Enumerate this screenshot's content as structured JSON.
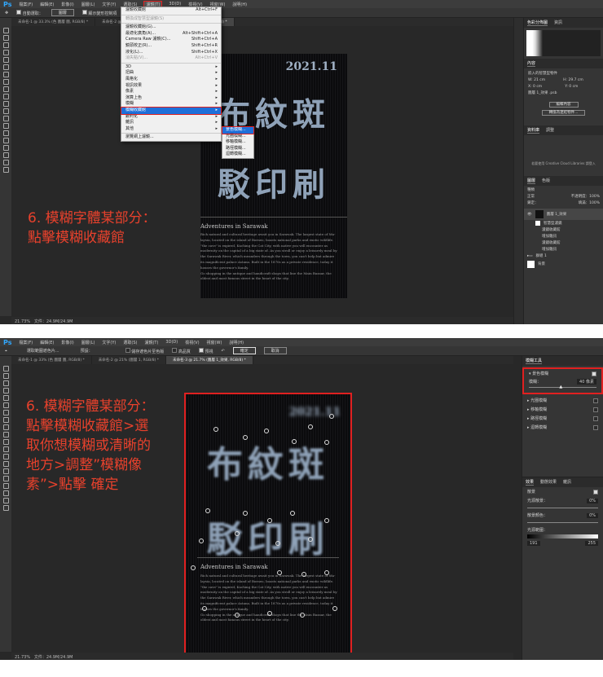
{
  "menubar": {
    "logo": "Ps",
    "items": [
      "檔案(F)",
      "編輯(E)",
      "影像(I)",
      "圖層(L)",
      "文字(Y)",
      "選取(S)",
      "濾鏡(T)",
      "3D(D)",
      "檢視(V)",
      "視窗(W)",
      "說明(H)"
    ]
  },
  "top": {
    "options": {
      "auto_select": "自動選取：",
      "auto_select_value": "圖層",
      "show_transform": "顯示變形控制項"
    },
    "tabs": [
      "未命名-1 @ 33.3% (色 圖層 圖, RGB/8) *",
      "未命名-2 @ 21% (圖層 1, RGB/8) *",
      "未命名-3 @ 21.7% (RGB/8) *"
    ],
    "filter_menu": [
      {
        "label": "濾鏡收藏館",
        "shortcut": "Alt+Ctrl+F"
      },
      {
        "label": "轉換成智慧型濾鏡(S)",
        "shortcut": "",
        "disabled": true
      },
      {
        "label": "濾鏡收藏館(G)...",
        "shortcut": ""
      },
      {
        "label": "最適化廣角(A)...",
        "shortcut": "Alt+Shift+Ctrl+A"
      },
      {
        "label": "Camera Raw 濾鏡(C)...",
        "shortcut": "Shift+Ctrl+A"
      },
      {
        "label": "鏡頭校正(R)...",
        "shortcut": "Shift+Ctrl+R"
      },
      {
        "label": "液化(L)...",
        "shortcut": "Shift+Ctrl+X"
      },
      {
        "label": "消失點(V)...",
        "shortcut": "Alt+Ctrl+V",
        "disabled": true
      },
      {
        "label": "3D",
        "shortcut": "▸"
      },
      {
        "label": "扭曲",
        "shortcut": "▸"
      },
      {
        "label": "風格化",
        "shortcut": "▸"
      },
      {
        "label": "視訊效果",
        "shortcut": "▸"
      },
      {
        "label": "像素",
        "shortcut": "▸"
      },
      {
        "label": "演算上色",
        "shortcut": "▸"
      },
      {
        "label": "模糊",
        "shortcut": "▸"
      },
      {
        "label": "模糊收藏館",
        "shortcut": "▸",
        "highlight": true
      },
      {
        "label": "銳利化",
        "shortcut": "▸"
      },
      {
        "label": "雜訊",
        "shortcut": "▸"
      },
      {
        "label": "其他",
        "shortcut": "▸"
      },
      {
        "label": "瀏覽網上濾鏡...",
        "shortcut": ""
      }
    ],
    "blur_submenu": [
      "景色模糊...",
      "光圈模糊...",
      "移軸模糊...",
      "路徑模糊...",
      "迴轉模糊..."
    ],
    "note": [
      "6. 模糊字體某部分：",
      "點擊模糊收藏館"
    ],
    "status": {
      "zoom": "21.73%",
      "doc": "文件：24.9M/24.9M"
    },
    "panels": {
      "histogram_tabs": [
        "色彩分佈圖",
        "資訊"
      ],
      "properties_tab": "內容",
      "properties_title": "嵌入的智慧型物件",
      "w": "W: 21 cm",
      "h": "H: 29.7 cm",
      "x": "X: 0 cm",
      "y": "Y: 0 cm",
      "file": "圖層 1_效果 .psb",
      "edit_contents": "編輯內容",
      "convert_linked": "轉換為連結物件...",
      "libraries_tabs": [
        "資料庫",
        "調整"
      ],
      "libraries_msg": "若要使用 Creative Cloud Libraries 請登入",
      "layers_tabs": [
        "圖層",
        "色版"
      ],
      "kind": "種類",
      "blend": "正常",
      "opacity": "不透明度：100%",
      "lock": "鎖定：",
      "fill": "填滿：100%",
      "layers": [
        "圖層 1_效果",
        "智慧型濾鏡",
        "濾鏡收藏館",
        "增加雜訊",
        "濾鏡收藏館",
        "增加雜訊",
        "群組 1",
        "背景"
      ]
    }
  },
  "poster": {
    "date": "2021.11",
    "line1": "布紋斑",
    "line2": "駁印刷",
    "subtitle": "Adventures in Sarawak",
    "body": [
      "Rich natural and cultural heritage await you in Sarawak. The largest state of Ma-",
      "laysia, located on the island of Borneo, boasts national parks and exotic wildlife.",
      "\"the cave\" is expired, Kuching the Cat City, with native you will encounter as",
      "modernity on the capital of a big state of. As you stroll or enjoy a leisurely meal by",
      "the Sarawak River, which meanders through the town, you can't help but admire",
      "its magnificent palace Astana. Built in the 1870s as a private residence, today it",
      "houses the governor's family.",
      "Go shopping in the antique and handicraft shops that line the Main Bazaar, the",
      "oldest and most famous street in the heart of the city."
    ]
  },
  "bottom": {
    "options": {
      "preset": "選取範圍遮色片...",
      "default": "預設：",
      "save_mask": "儲存遮色片至色版",
      "high_quality": "高品質",
      "preview": "預視",
      "ok": "確定",
      "cancel": "取消"
    },
    "tabs": [
      "未命名-1 @ 33% (色 圖層 圖, RGB/8) *",
      "未命名-2 @ 21% (圖層 1, RGB/8) *",
      "未命名-3 @ 21.7% (圖層 1_效果, RGB/8) *"
    ],
    "note": [
      "6. 模糊字體某部分：",
      "點擊模糊收藏館>選",
      "取你想模糊或清晰的",
      "地方>調整”模糊像",
      "素”>點擊 確定"
    ],
    "status": {
      "zoom": "21.73%",
      "doc": "文件：24.9M/24.9M"
    },
    "blur_tools": {
      "title": "模糊工具",
      "items": [
        "景色模糊",
        "光圈模糊",
        "移軸模糊",
        "路徑模糊",
        "迴轉模糊"
      ],
      "blur_label": "模糊：",
      "blur_value": "40 像素"
    },
    "effects": {
      "tabs": [
        "效果",
        "動態效果",
        "雜訊"
      ],
      "bokeh": "散景",
      "light_bokeh": "光源散景：",
      "light_bokeh_value": "0%",
      "bokeh_color": "散景顏色：",
      "bokeh_color_value": "0%",
      "light_range": "光源範圍：",
      "range_low": "191",
      "range_high": "255"
    }
  },
  "colors": {
    "accent": "#e02020",
    "highlight": "#1e6fd9",
    "note": "#e8412c"
  }
}
